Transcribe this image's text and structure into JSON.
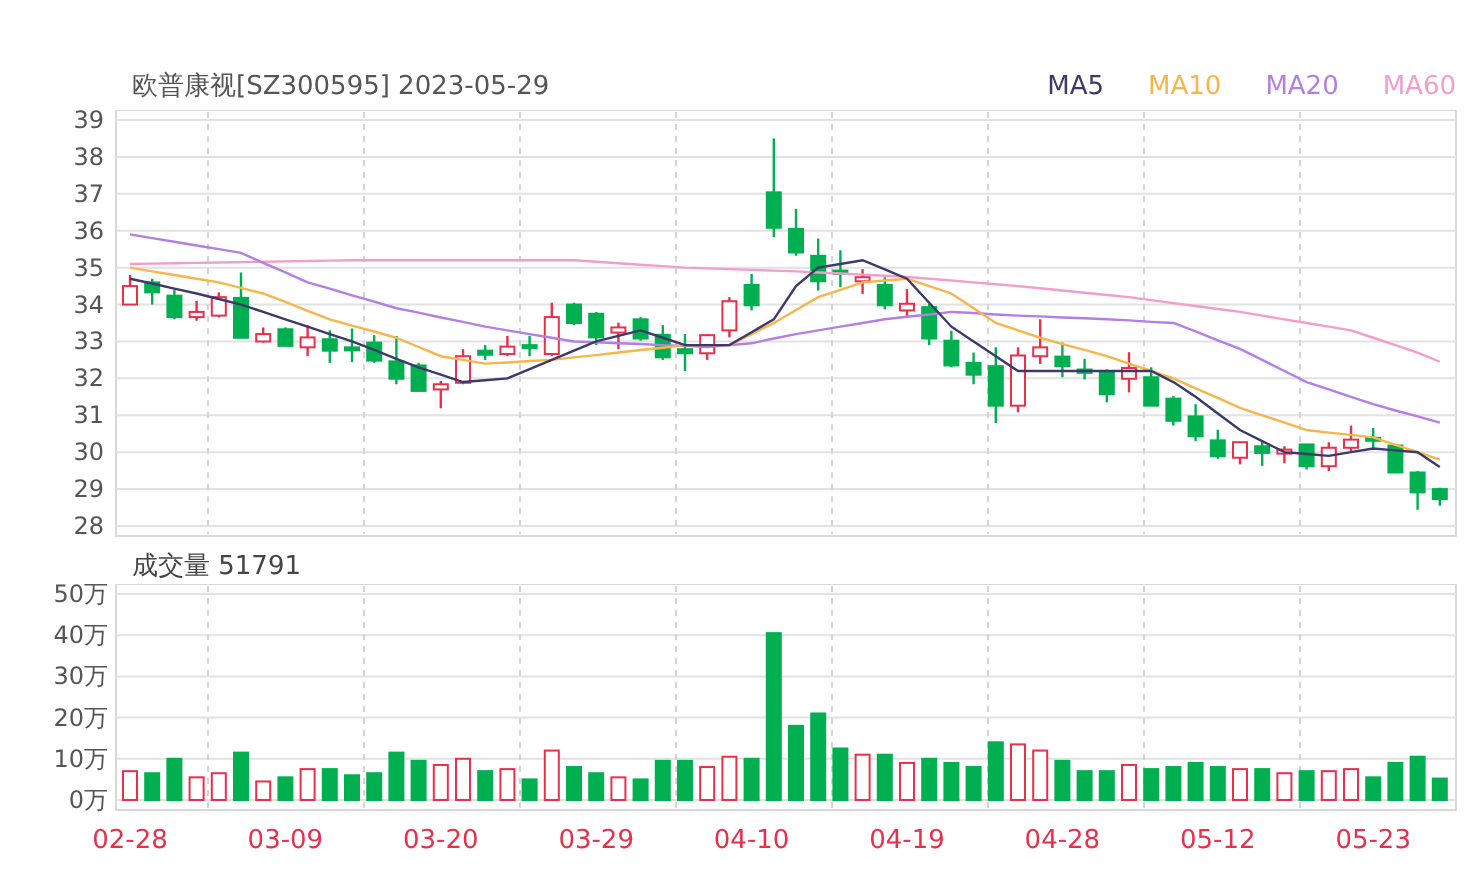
{
  "title": "欧普康视[SZ300595] 2023-05-29",
  "price_chart": {
    "chart_data": {
      "type": "candlestick",
      "grid": true,
      "ylim": [
        28,
        39
      ],
      "yticks": [
        28,
        29,
        30,
        31,
        32,
        33,
        34,
        35,
        36,
        37,
        38,
        39
      ],
      "categories": [
        null,
        null,
        null,
        null,
        null,
        null,
        null,
        null,
        null,
        null,
        null,
        null,
        null,
        null,
        null,
        null,
        null,
        null,
        null,
        null,
        null,
        null,
        null,
        null,
        null,
        null,
        null,
        null,
        null,
        null,
        null,
        null,
        null,
        null,
        null,
        null,
        null,
        null,
        null,
        null,
        null,
        null,
        null,
        null,
        null,
        null,
        null,
        null,
        null,
        null,
        null,
        null,
        null,
        null,
        null,
        null,
        null,
        null,
        null,
        null
      ],
      "ohlc": [
        [
          34.0,
          34.8,
          34.0,
          34.5
        ],
        [
          34.6,
          34.7,
          34.0,
          34.33
        ],
        [
          34.24,
          34.4,
          33.6,
          33.66
        ],
        [
          33.66,
          34.1,
          33.56,
          33.8
        ],
        [
          33.7,
          34.33,
          33.65,
          34.2
        ],
        [
          34.18,
          34.87,
          33.1,
          33.1
        ],
        [
          33.0,
          33.38,
          32.97,
          33.2
        ],
        [
          33.33,
          33.38,
          32.88,
          32.88
        ],
        [
          32.84,
          33.44,
          32.6,
          33.11
        ],
        [
          33.06,
          33.3,
          32.42,
          32.75
        ],
        [
          32.84,
          33.35,
          32.44,
          32.79
        ],
        [
          32.97,
          33.17,
          32.42,
          32.48
        ],
        [
          32.46,
          33.15,
          31.84,
          31.99
        ],
        [
          32.35,
          32.42,
          31.66,
          31.66
        ],
        [
          31.7,
          31.93,
          31.19,
          31.84
        ],
        [
          31.88,
          32.79,
          31.84,
          32.6
        ],
        [
          32.75,
          32.9,
          32.5,
          32.64
        ],
        [
          32.66,
          33.15,
          32.6,
          32.86
        ],
        [
          32.9,
          33.15,
          32.6,
          32.86
        ],
        [
          32.66,
          34.05,
          32.6,
          33.66
        ],
        [
          34.0,
          34.05,
          33.44,
          33.5
        ],
        [
          33.75,
          33.8,
          32.9,
          33.11
        ],
        [
          33.24,
          33.51,
          32.79,
          33.38
        ],
        [
          33.6,
          33.66,
          33.02,
          33.08
        ],
        [
          33.18,
          33.44,
          32.5,
          32.57
        ],
        [
          32.79,
          33.2,
          32.2,
          32.68
        ],
        [
          32.68,
          33.2,
          32.5,
          33.17
        ],
        [
          33.3,
          34.2,
          33.11,
          34.09
        ],
        [
          34.53,
          34.83,
          33.84,
          33.98
        ],
        [
          37.04,
          38.5,
          35.83,
          36.08
        ],
        [
          36.05,
          36.59,
          35.32,
          35.41
        ],
        [
          35.32,
          35.79,
          34.38,
          34.63
        ],
        [
          34.92,
          35.47,
          34.47,
          34.83
        ],
        [
          34.63,
          34.96,
          34.29,
          34.74
        ],
        [
          34.53,
          34.74,
          33.87,
          33.98
        ],
        [
          33.84,
          34.42,
          33.69,
          34.02
        ],
        [
          33.93,
          34.02,
          32.9,
          33.08
        ],
        [
          33.02,
          33.29,
          32.3,
          32.35
        ],
        [
          32.42,
          32.7,
          31.84,
          32.1
        ],
        [
          32.33,
          32.84,
          30.79,
          31.26
        ],
        [
          31.26,
          32.84,
          31.08,
          32.62
        ],
        [
          32.6,
          33.6,
          32.39,
          32.84
        ],
        [
          32.59,
          32.97,
          32.03,
          32.33
        ],
        [
          32.24,
          32.53,
          31.97,
          32.15
        ],
        [
          32.17,
          32.24,
          31.35,
          31.57
        ],
        [
          31.99,
          32.71,
          31.62,
          32.28
        ],
        [
          32.03,
          32.3,
          31.26,
          31.26
        ],
        [
          31.45,
          31.52,
          30.72,
          30.85
        ],
        [
          30.97,
          31.3,
          30.3,
          30.43
        ],
        [
          30.32,
          30.61,
          29.82,
          29.89
        ],
        [
          29.85,
          30.27,
          29.67,
          30.27
        ],
        [
          30.16,
          30.3,
          29.63,
          29.98
        ],
        [
          29.96,
          30.16,
          29.7,
          30.07
        ],
        [
          30.21,
          30.21,
          29.53,
          29.62
        ],
        [
          29.62,
          30.27,
          29.49,
          30.12
        ],
        [
          30.12,
          30.72,
          30.03,
          30.34
        ],
        [
          30.39,
          30.66,
          30.07,
          30.32
        ],
        [
          30.18,
          30.21,
          29.45,
          29.45
        ],
        [
          29.45,
          29.49,
          28.44,
          28.91
        ],
        [
          29.0,
          29.04,
          28.55,
          28.73
        ]
      ],
      "series": [
        {
          "name": "MA5",
          "type": "line",
          "color": "#3d3a6b",
          "values": [
            34.7,
            34.57,
            34.43,
            34.3,
            34.15,
            34.0,
            33.8,
            33.6,
            33.4,
            33.2,
            33.0,
            32.77,
            32.53,
            32.3,
            32.1,
            31.9,
            31.95,
            32.0,
            32.25,
            32.5,
            32.75,
            33.0,
            33.15,
            33.3,
            33.1,
            32.9,
            32.9,
            32.9,
            33.25,
            33.6,
            34.5,
            35.0,
            35.1,
            35.2,
            34.95,
            34.7,
            34.05,
            33.4,
            33.0,
            32.6,
            32.2,
            32.2,
            32.2,
            32.2,
            32.2,
            32.2,
            32.2,
            31.9,
            31.5,
            31.05,
            30.6,
            30.3,
            30.0,
            29.95,
            29.9,
            30.0,
            30.1,
            30.05,
            30.0,
            29.6
          ]
        },
        {
          "name": "MA10",
          "type": "line",
          "color": "#f7b54a",
          "values": [
            35.0,
            34.9,
            34.8,
            34.7,
            34.6,
            34.45,
            34.3,
            34.07,
            33.83,
            33.6,
            33.43,
            33.27,
            33.1,
            32.85,
            32.6,
            32.5,
            32.4,
            32.43,
            32.47,
            32.5,
            32.57,
            32.63,
            32.7,
            32.77,
            32.83,
            32.9,
            32.9,
            32.9,
            33.2,
            33.5,
            33.85,
            34.2,
            34.4,
            34.6,
            34.65,
            34.7,
            34.5,
            34.3,
            33.9,
            33.5,
            33.3,
            33.1,
            32.93,
            32.77,
            32.6,
            32.4,
            32.2,
            32.0,
            31.73,
            31.47,
            31.2,
            31.0,
            30.8,
            30.6,
            30.53,
            30.47,
            30.4,
            30.2,
            30.0,
            29.8
          ]
        },
        {
          "name": "MA20",
          "type": "line",
          "color": "#b47ee8",
          "values": [
            35.9,
            35.8,
            35.7,
            35.6,
            35.5,
            35.4,
            35.13,
            34.87,
            34.6,
            34.43,
            34.25,
            34.08,
            33.9,
            33.78,
            33.65,
            33.53,
            33.4,
            33.3,
            33.2,
            33.1,
            33.0,
            32.98,
            32.95,
            32.93,
            32.9,
            32.88,
            32.85,
            32.9,
            32.95,
            33.08,
            33.2,
            33.3,
            33.4,
            33.5,
            33.6,
            33.67,
            33.73,
            33.8,
            33.77,
            33.73,
            33.7,
            33.68,
            33.65,
            33.63,
            33.6,
            33.57,
            33.53,
            33.5,
            33.27,
            33.03,
            32.8,
            32.5,
            32.2,
            31.9,
            31.7,
            31.5,
            31.3,
            31.13,
            30.97,
            30.8
          ]
        },
        {
          "name": "MA60",
          "type": "line",
          "color": "#f49ccb",
          "values": [
            35.1,
            35.11,
            35.12,
            35.13,
            35.14,
            35.15,
            35.16,
            35.17,
            35.18,
            35.19,
            35.2,
            35.2,
            35.2,
            35.2,
            35.2,
            35.2,
            35.2,
            35.2,
            35.2,
            35.2,
            35.2,
            35.16,
            35.12,
            35.08,
            35.04,
            35.0,
            34.98,
            34.96,
            34.94,
            34.92,
            34.9,
            34.87,
            34.84,
            34.81,
            34.78,
            34.75,
            34.7,
            34.65,
            34.6,
            34.55,
            34.5,
            34.44,
            34.38,
            34.32,
            34.26,
            34.2,
            34.12,
            34.04,
            33.96,
            33.88,
            33.8,
            33.7,
            33.6,
            33.5,
            33.4,
            33.3,
            33.1,
            32.9,
            32.7,
            32.45
          ]
        }
      ]
    }
  },
  "volume_chart": {
    "label": "成交量 51791",
    "chart_data": {
      "type": "bar",
      "grid": true,
      "ylim": [
        0,
        50
      ],
      "categories": [
        "02-28",
        null,
        null,
        null,
        null,
        null,
        null,
        "03-09",
        null,
        null,
        null,
        null,
        null,
        null,
        "03-20",
        null,
        null,
        null,
        null,
        null,
        null,
        "03-29",
        null,
        null,
        null,
        null,
        null,
        null,
        "04-10",
        null,
        null,
        null,
        null,
        null,
        null,
        "04-19",
        null,
        null,
        null,
        null,
        null,
        null,
        "04-28",
        null,
        null,
        null,
        null,
        null,
        null,
        "05-12",
        null,
        null,
        null,
        null,
        null,
        null,
        "05-23",
        null,
        null,
        null
      ],
      "yticks": [
        {
          "value": 0,
          "label": "0万"
        },
        {
          "value": 10,
          "label": "10万"
        },
        {
          "value": 20,
          "label": "20万"
        },
        {
          "value": 30,
          "label": "30万"
        },
        {
          "value": 40,
          "label": "40万"
        },
        {
          "value": 50,
          "label": "50万"
        }
      ],
      "values": [
        7,
        6.5,
        10,
        5.5,
        6.5,
        11.5,
        4.5,
        5.5,
        7.5,
        7.5,
        6,
        6.5,
        11.5,
        9.5,
        8.5,
        10,
        7,
        7.5,
        5,
        12,
        8,
        6.5,
        5.5,
        5,
        9.5,
        9.5,
        8,
        10.5,
        10,
        40.5,
        18,
        21,
        12.5,
        11,
        11,
        9,
        10,
        9,
        8,
        14,
        13.5,
        12,
        9.5,
        7,
        7,
        8.5,
        7.5,
        8,
        9,
        8,
        7.5,
        7.5,
        6.5,
        7,
        7,
        7.5,
        5.5,
        9,
        10.5,
        5.2
      ]
    }
  }
}
